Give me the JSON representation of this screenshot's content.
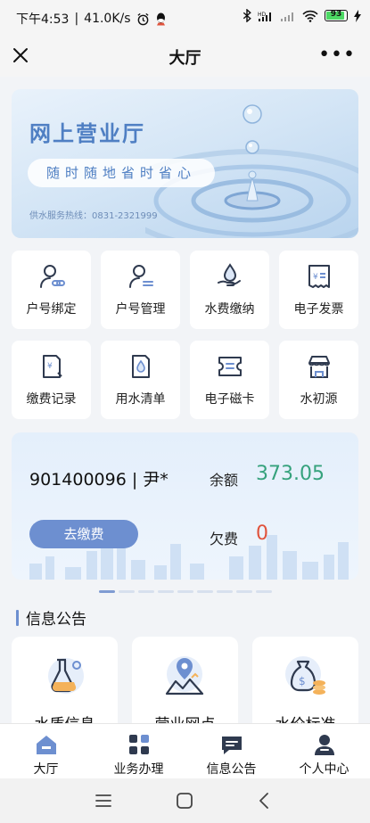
{
  "status_bar": {
    "time": "下午4:53",
    "net_speed": "41.0K/s",
    "battery": "93",
    "colors": {
      "battery_fill": "#4cd964"
    }
  },
  "navbar": {
    "title": "大厅",
    "close_icon": "close-icon",
    "more_icon": "more-icon",
    "more_glyph": "•••"
  },
  "banner": {
    "title": "网上营业厅",
    "slogan": "随时随地省时省心",
    "hotline": "供水服务热线：0831-2321999"
  },
  "services": {
    "row1": [
      {
        "label": "户号绑定",
        "icon": "user-link-icon"
      },
      {
        "label": "户号管理",
        "icon": "user-manage-icon"
      },
      {
        "label": "水费缴纳",
        "icon": "water-payment-icon"
      },
      {
        "label": "电子发票",
        "icon": "invoice-icon"
      }
    ],
    "row2": [
      {
        "label": "缴费记录",
        "icon": "payment-record-icon"
      },
      {
        "label": "用水清单",
        "icon": "water-usage-icon"
      },
      {
        "label": "电子磁卡",
        "icon": "card-icon"
      },
      {
        "label": "水初源",
        "icon": "shop-icon"
      }
    ]
  },
  "account": {
    "id": "901400096 | 尹*",
    "balance_label": "余额",
    "balance_value": "373.05",
    "arrears_label": "欠费",
    "arrears_value": "0",
    "pay_button": "去缴费",
    "colors": {
      "balance": "#36a27d",
      "arrears": "#e0533c",
      "button": "#6d8fd0"
    }
  },
  "carousel": {
    "page_count": 9,
    "active_index": 0
  },
  "notices": {
    "title": "信息公告",
    "items": [
      {
        "label": "水质信息",
        "icon": "flask-icon"
      },
      {
        "label": "营业网点",
        "icon": "map-pin-icon"
      },
      {
        "label": "水价标准",
        "icon": "money-bag-icon"
      }
    ]
  },
  "tabbar": {
    "tabs": [
      {
        "label": "大厅",
        "icon": "home-icon",
        "active": true
      },
      {
        "label": "业务办理",
        "icon": "grid-icon",
        "active": false
      },
      {
        "label": "信息公告",
        "icon": "message-icon",
        "active": false
      },
      {
        "label": "个人中心",
        "icon": "person-icon",
        "active": false
      }
    ]
  },
  "system_nav": {
    "buttons": [
      "menu-icon",
      "home-button-icon",
      "back-icon"
    ]
  },
  "theme": {
    "accent": "#6d8fd0",
    "accent_dark": "#4f7fc3",
    "icon_dark": "#2f3a4f"
  }
}
